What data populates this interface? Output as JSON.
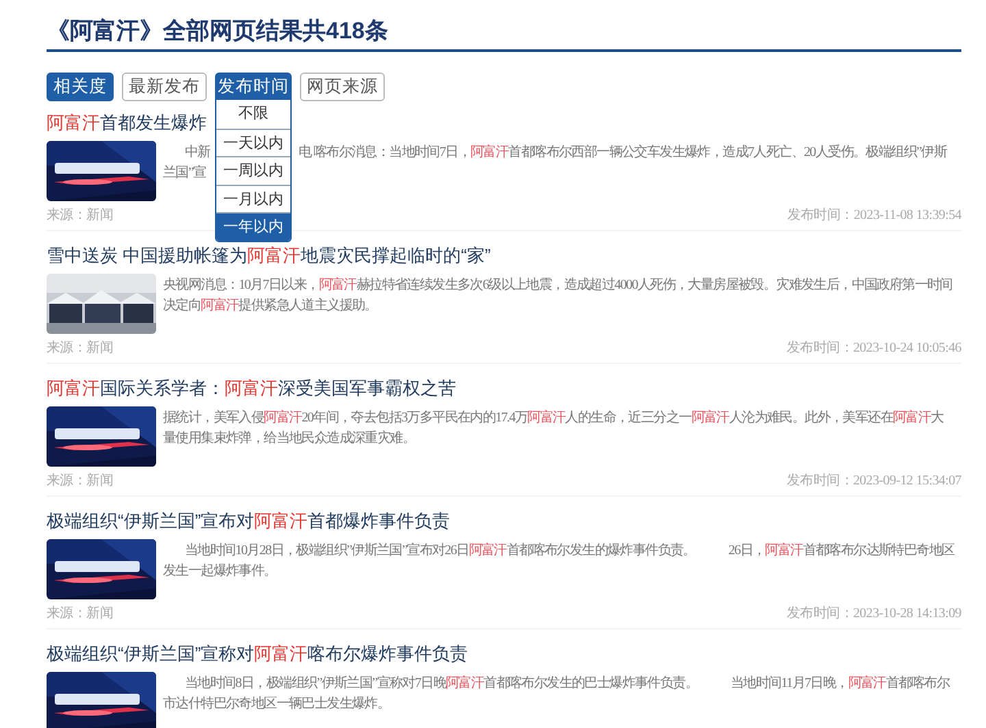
{
  "heading": "《阿富汗》全部网页结果共418条",
  "tabs": [
    {
      "label": "相关度",
      "selected": true
    },
    {
      "label": "最新发布",
      "selected": false
    },
    {
      "label": "发布时间",
      "selected": true,
      "expanded": true
    },
    {
      "label": "网页来源",
      "selected": false
    }
  ],
  "time_menu": [
    {
      "label": "不限",
      "selected": false
    },
    {
      "label": "一天以内",
      "selected": false
    },
    {
      "label": "一周以内",
      "selected": false
    },
    {
      "label": "一月以内",
      "selected": false
    },
    {
      "label": "一年以内",
      "selected": true
    }
  ],
  "results": [
    {
      "title": [
        {
          "text": "阿富汗",
          "highlight": true
        },
        {
          "text": "首都发生爆炸",
          "highlight": false
        }
      ],
      "kind": "picture",
      "indented": true,
      "lines": [
        [
          [
            {
              "text": "中新",
              "highlight": false
            }
          ],
          [
            {
              "text": "电  喀布尔消息：当地时间7日，",
              "highlight": false
            },
            {
              "text": "阿富汗",
              "highlight": true
            },
            {
              "text": "首都喀布尔西部一辆公交车发生爆炸，造成7人死亡、20人受伤。极端组织”伊斯",
              "highlight": false
            }
          ]
        ],
        [
          [
            {
              "text": "兰国”宣",
              "highlight": false
            }
          ]
        ]
      ],
      "source": "来源：新闻",
      "time": "发布时间：2023-11-08 13:39:54"
    },
    {
      "title": [
        {
          "text": "雪中送炭 中国援助帐篷为",
          "highlight": false
        },
        {
          "text": "阿富汗",
          "highlight": true
        },
        {
          "text": "地震灾民撑起临时的“家”",
          "highlight": false
        }
      ],
      "kind": "picture",
      "indented": false,
      "lines": [
        [
          [
            {
              "text": "央视网消息：10月7日以来，",
              "highlight": false
            },
            {
              "text": "阿富汗",
              "highlight": true
            },
            {
              "text": "赫拉特省连续发生多次6级以上地震，造成超过4000人死伤，大量房屋被毁。灾难发生后，中国政府第一时间",
              "highlight": false
            }
          ]
        ],
        [
          [
            {
              "text": "决定向",
              "highlight": false
            },
            {
              "text": "阿富汗",
              "highlight": true
            },
            {
              "text": "提供紧急人道主义援助。",
              "highlight": false
            }
          ]
        ]
      ],
      "source": "来源：新闻",
      "time": "发布时间：2023-10-24 10:05:46"
    },
    {
      "title": [
        {
          "text": "阿富汗",
          "highlight": true
        },
        {
          "text": "国际关系学者：",
          "highlight": false
        },
        {
          "text": "阿富汗",
          "highlight": true
        },
        {
          "text": "深受美国军事霸权之苦",
          "highlight": false
        }
      ],
      "kind": "picture",
      "indented": false,
      "lines": [
        [
          [
            {
              "text": "据统计，美军入侵",
              "highlight": false
            },
            {
              "text": "阿富汗",
              "highlight": true
            },
            {
              "text": "20年间，夺去包括3万多平民在内的17.4万",
              "highlight": false
            },
            {
              "text": "阿富汗",
              "highlight": true
            },
            {
              "text": "人的生命，近三分之一",
              "highlight": false
            },
            {
              "text": "阿富汗",
              "highlight": true
            },
            {
              "text": "人沦为难民。此外，美军还在",
              "highlight": false
            },
            {
              "text": "阿富汗",
              "highlight": true
            },
            {
              "text": "大",
              "highlight": false
            }
          ]
        ],
        [
          [
            {
              "text": "量使用集束炸弹，给当地民众造成深重灾难。",
              "highlight": false
            }
          ]
        ]
      ],
      "source": "来源：新闻",
      "time": "发布时间：2023-09-12 15:34:07"
    },
    {
      "title": [
        {
          "text": "极端组织“伊斯兰国”宣布对",
          "highlight": false
        },
        {
          "text": "阿富汗",
          "highlight": true
        },
        {
          "text": "首都爆炸事件负责",
          "highlight": false
        }
      ],
      "kind": "picture",
      "indented": true,
      "lines": [
        [
          [
            {
              "text": "当地时间10月28日，极端组织”伊斯兰国”宣布对26日",
              "highlight": false
            },
            {
              "text": "阿富汗",
              "highlight": true
            },
            {
              "text": "首都喀布尔发生的爆炸事件负责。",
              "highlight": false
            }
          ],
          [
            {
              "text": "26日，",
              "highlight": false
            },
            {
              "text": "阿富汗",
              "highlight": true
            },
            {
              "text": "首都喀布尔达斯特巴奇地区",
              "highlight": false
            }
          ]
        ],
        [
          [
            {
              "text": "发生一起爆炸事件。",
              "highlight": false
            }
          ]
        ]
      ],
      "source": "来源：新闻",
      "time": "发布时间：2023-10-28 14:13:09"
    },
    {
      "title": [
        {
          "text": "极端组织“伊斯兰国”宣称对",
          "highlight": false
        },
        {
          "text": "阿富汗",
          "highlight": true
        },
        {
          "text": "喀布尔爆炸事件负责",
          "highlight": false
        }
      ],
      "kind": "picture",
      "indented": true,
      "lines": [
        [
          [
            {
              "text": "当地时间8日，极端组织”伊斯兰国”宣称对7日晚",
              "highlight": false
            },
            {
              "text": "阿富汗",
              "highlight": true
            },
            {
              "text": "首都喀布尔发生的巴士爆炸事件负责。",
              "highlight": false
            }
          ],
          [
            {
              "text": "当地时间11月7日晚，",
              "highlight": false
            },
            {
              "text": "阿富汗",
              "highlight": true
            },
            {
              "text": "首都喀布尔",
              "highlight": false
            }
          ]
        ],
        [
          [
            {
              "text": "市达什特巴尔奇地区一辆巴士发生爆炸。",
              "highlight": false
            }
          ]
        ]
      ]
    }
  ]
}
